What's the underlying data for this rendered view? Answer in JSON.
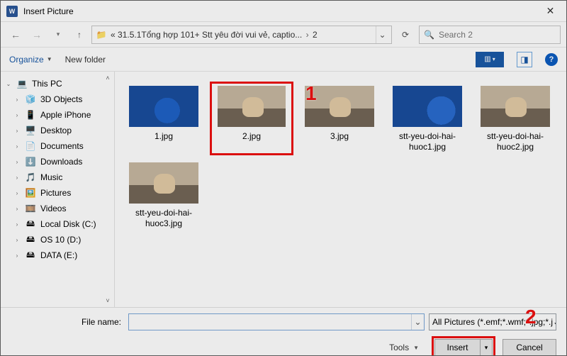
{
  "window": {
    "title": "Insert Picture"
  },
  "nav": {
    "path_prefix": "«",
    "path_part1": "31.5.1Tổng hợp 101+ Stt yêu đời vui vẻ, captio...",
    "path_part2": "2"
  },
  "search": {
    "placeholder": "Search 2"
  },
  "toolbar": {
    "organize": "Organize",
    "newfolder": "New folder"
  },
  "tree": {
    "root": "This PC",
    "items": [
      "3D Objects",
      "Apple iPhone",
      "Desktop",
      "Documents",
      "Downloads",
      "Music",
      "Pictures",
      "Videos",
      "Local Disk (C:)",
      "OS 10 (D:)",
      "DATA (E:)"
    ]
  },
  "files": [
    {
      "name": "1.jpg"
    },
    {
      "name": "2.jpg"
    },
    {
      "name": "3.jpg"
    },
    {
      "name": "stt-yeu-doi-hai-huoc1.jpg"
    },
    {
      "name": "stt-yeu-doi-hai-huoc2.jpg"
    },
    {
      "name": "stt-yeu-doi-hai-huoc3.jpg"
    }
  ],
  "footer": {
    "filename_label": "File name:",
    "filename_value": "",
    "filter_label": "All Pictures (*.emf;*.wmf;*.jpg;*.j",
    "tools": "Tools",
    "insert": "Insert",
    "cancel": "Cancel"
  },
  "annotations": {
    "n1": "1",
    "n2": "2"
  }
}
